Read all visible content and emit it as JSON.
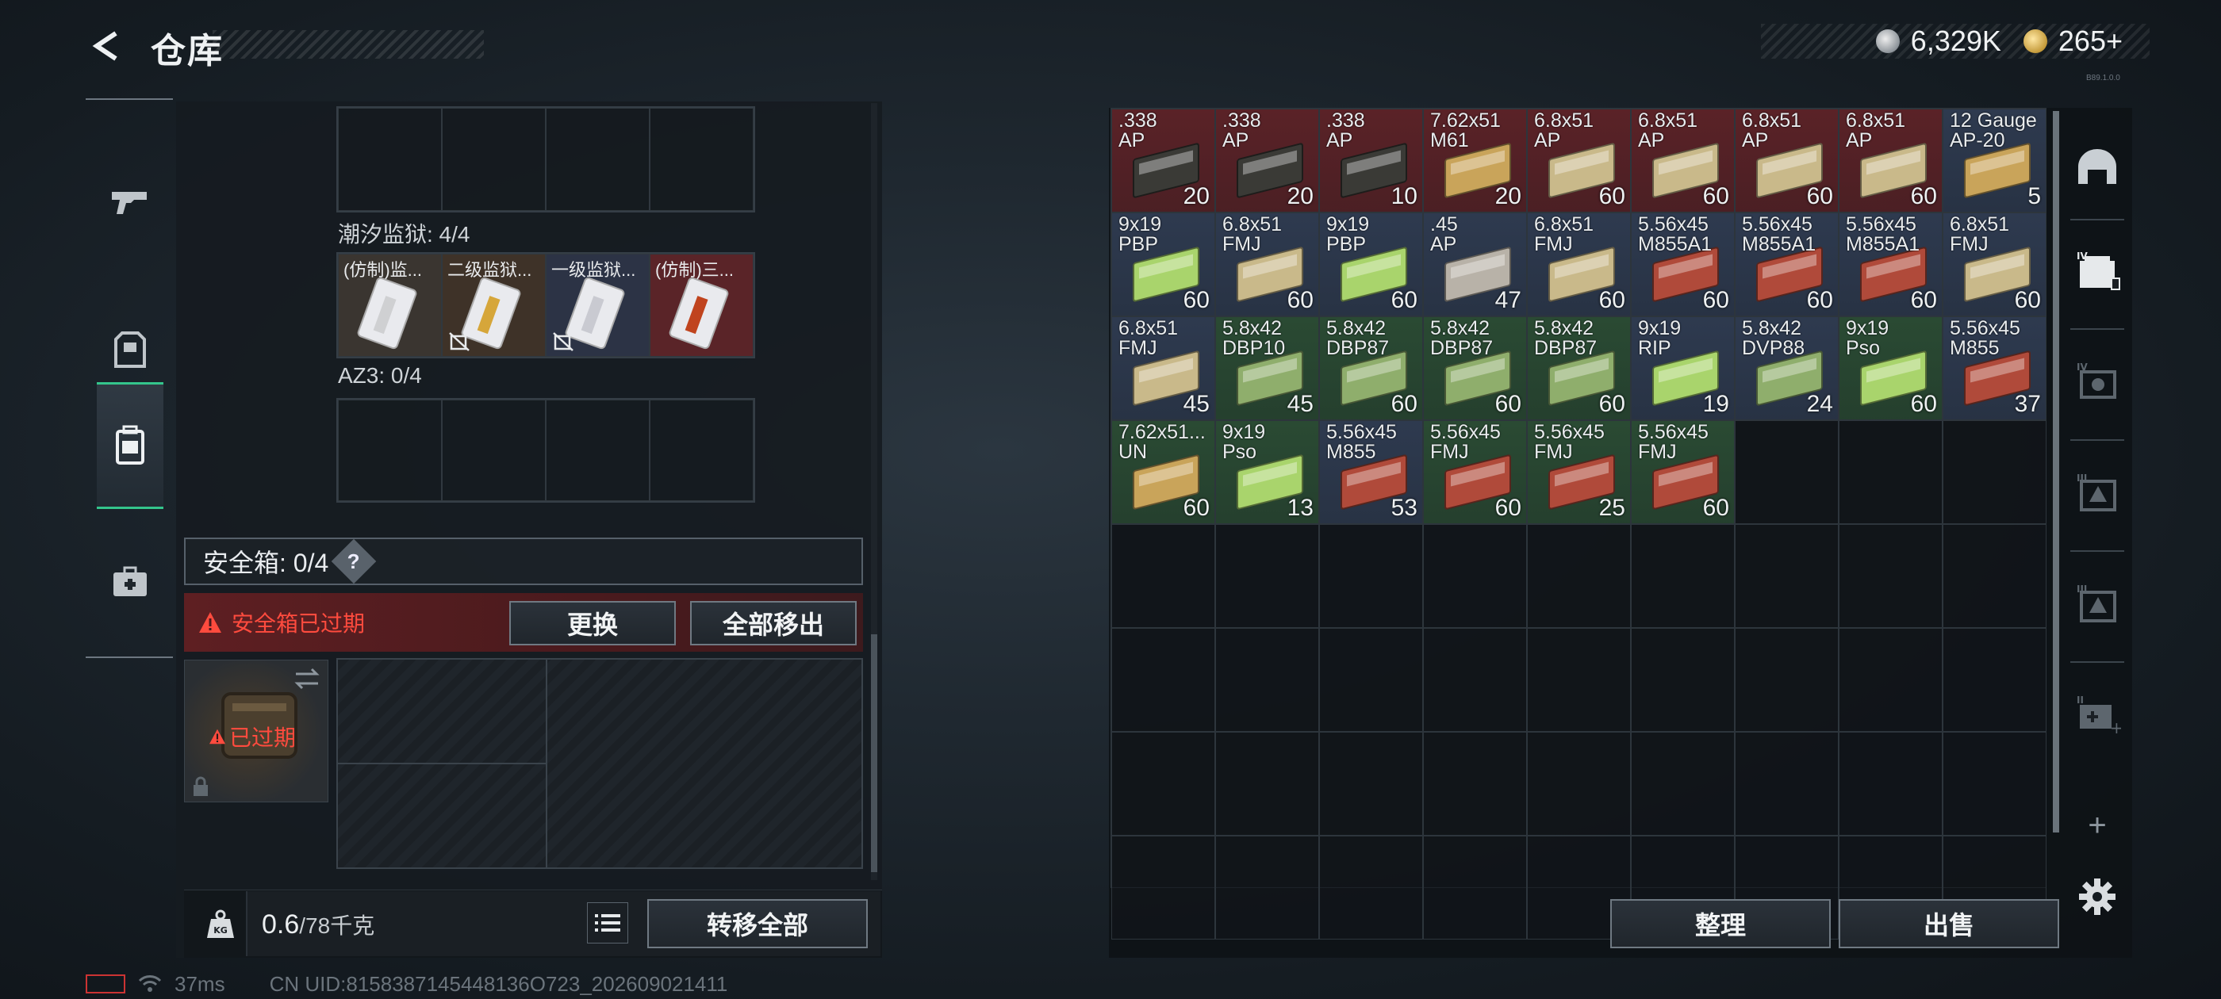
{
  "header": {
    "title": "仓库",
    "silver": "6,329K",
    "gold": "265+"
  },
  "version": "B89.1.0.0",
  "leftnav": [
    "gun-icon",
    "armor-icon",
    "backpack-icon",
    "medkit-icon"
  ],
  "containers": {
    "row0": {
      "filled": 0,
      "total": 4
    },
    "chaoxi": {
      "label": "潮汐监狱: 4/4",
      "items": [
        {
          "name": "(仿制)监...",
          "color": "#cfd0d2",
          "badge": false,
          "bg": "#3a3530"
        },
        {
          "name": "二级监狱...",
          "color": "#d6a63a",
          "badge": true,
          "bg": "#3e3228"
        },
        {
          "name": "一级监狱...",
          "color": "#c9cad1",
          "badge": true,
          "bg": "#2c3345"
        },
        {
          "name": "(仿制)三...",
          "color": "#c0441e",
          "badge": false,
          "bg": "#5a2428"
        }
      ]
    },
    "az3": {
      "label": "AZ3: 0/4"
    }
  },
  "safe_case": {
    "label": "安全箱: 0/4",
    "help": "?",
    "expired_text": "安全箱已过期",
    "replace_btn": "更换",
    "move_all_btn": "全部移出",
    "case_status": "已过期"
  },
  "weight": {
    "current": "0.6",
    "max": "/78千克",
    "transfer_btn": "转移全部"
  },
  "inventory": [
    {
      "n": ".338\nAP",
      "q": "20",
      "bg": "#5a2227",
      "box": "#3a3a36"
    },
    {
      "n": ".338\nAP",
      "q": "20",
      "bg": "#5a2227",
      "box": "#3a3a36"
    },
    {
      "n": ".338\nAP",
      "q": "10",
      "bg": "#5a2227",
      "box": "#3a3a36"
    },
    {
      "n": "7.62x51\nM61",
      "q": "20",
      "bg": "#5a2227",
      "box": "#c9a45a"
    },
    {
      "n": "6.8x51\nAP",
      "q": "60",
      "bg": "#5a2227",
      "box": "#c9b98a"
    },
    {
      "n": "6.8x51\nAP",
      "q": "60",
      "bg": "#5a2227",
      "box": "#c9b98a"
    },
    {
      "n": "6.8x51\nAP",
      "q": "60",
      "bg": "#5a2227",
      "box": "#c9b98a"
    },
    {
      "n": "6.8x51\nAP",
      "q": "60",
      "bg": "#5a2227",
      "box": "#c9b98a"
    },
    {
      "n": "12 Gauge\nAP-20",
      "q": "5",
      "bg": "#2e3a4f",
      "box": "#c9a45a"
    },
    {
      "n": "9x19\nPBP",
      "q": "60",
      "bg": "#2e3a4f",
      "box": "#a9d46c"
    },
    {
      "n": "6.8x51\nFMJ",
      "q": "60",
      "bg": "#2e3a4f",
      "box": "#c9b98a"
    },
    {
      "n": "9x19\nPBP",
      "q": "60",
      "bg": "#2e3a4f",
      "box": "#a9d46c"
    },
    {
      "n": ".45\nAP",
      "q": "47",
      "bg": "#2e3a4f",
      "box": "#b8b2a8"
    },
    {
      "n": "6.8x51\nFMJ",
      "q": "60",
      "bg": "#2e3a4f",
      "box": "#c9b98a"
    },
    {
      "n": "5.56x45\nM855A1",
      "q": "60",
      "bg": "#2e3a4f",
      "box": "#b04a3a"
    },
    {
      "n": "5.56x45\nM855A1",
      "q": "60",
      "bg": "#2e3a4f",
      "box": "#b04a3a"
    },
    {
      "n": "5.56x45\nM855A1",
      "q": "60",
      "bg": "#2e3a4f",
      "box": "#b04a3a"
    },
    {
      "n": "6.8x51\nFMJ",
      "q": "60",
      "bg": "#2e3a4f",
      "box": "#c9b98a"
    },
    {
      "n": "6.8x51\nFMJ",
      "q": "45",
      "bg": "#2e3a4f",
      "box": "#c9b98a"
    },
    {
      "n": "5.8x42\nDBP10",
      "q": "45",
      "bg": "#2a4a33",
      "box": "#8fae6c"
    },
    {
      "n": "5.8x42\nDBP87",
      "q": "60",
      "bg": "#2a4a33",
      "box": "#8fae6c"
    },
    {
      "n": "5.8x42\nDBP87",
      "q": "60",
      "bg": "#2a4a33",
      "box": "#8fae6c"
    },
    {
      "n": "5.8x42\nDBP87",
      "q": "60",
      "bg": "#2a4a33",
      "box": "#8fae6c"
    },
    {
      "n": "9x19\nRIP",
      "q": "19",
      "bg": "#2e3a4f",
      "box": "#a9d46c"
    },
    {
      "n": "5.8x42\nDVP88",
      "q": "24",
      "bg": "#2e3a4f",
      "box": "#8fae6c"
    },
    {
      "n": "9x19\nPso",
      "q": "60",
      "bg": "#2a4a33",
      "box": "#a9d46c"
    },
    {
      "n": "5.56x45\nM855",
      "q": "37",
      "bg": "#2e3a4f",
      "box": "#b04a3a"
    },
    {
      "n": "7.62x51...\nUN",
      "q": "60",
      "bg": "#2a4a33",
      "box": "#c9a45a"
    },
    {
      "n": "9x19\nPso",
      "q": "13",
      "bg": "#2a4a33",
      "box": "#a9d46c"
    },
    {
      "n": "5.56x45\nM855",
      "q": "53",
      "bg": "#2e3a4f",
      "box": "#b04a3a"
    },
    {
      "n": "5.56x45\nFMJ",
      "q": "60",
      "bg": "#2a4a33",
      "box": "#b04a3a"
    },
    {
      "n": "5.56x45\nFMJ",
      "q": "25",
      "bg": "#2a4a33",
      "box": "#b04a3a"
    },
    {
      "n": "5.56x45\nFMJ",
      "q": "60",
      "bg": "#2a4a33",
      "box": "#b04a3a"
    }
  ],
  "inventory_total_cells": 72,
  "right_tabs": [
    "helmet-icon",
    "stash-iv-icon",
    "stash-iv-2-icon",
    "stash-iii-icon",
    "stash-iii-2-icon",
    "stash-ii-icon"
  ],
  "actions": {
    "sort_btn": "整理",
    "sell_btn": "出售",
    "add": "+"
  },
  "status": {
    "ping": "37ms",
    "uid": "CN UID:8158387145448136O723_202609021411"
  }
}
